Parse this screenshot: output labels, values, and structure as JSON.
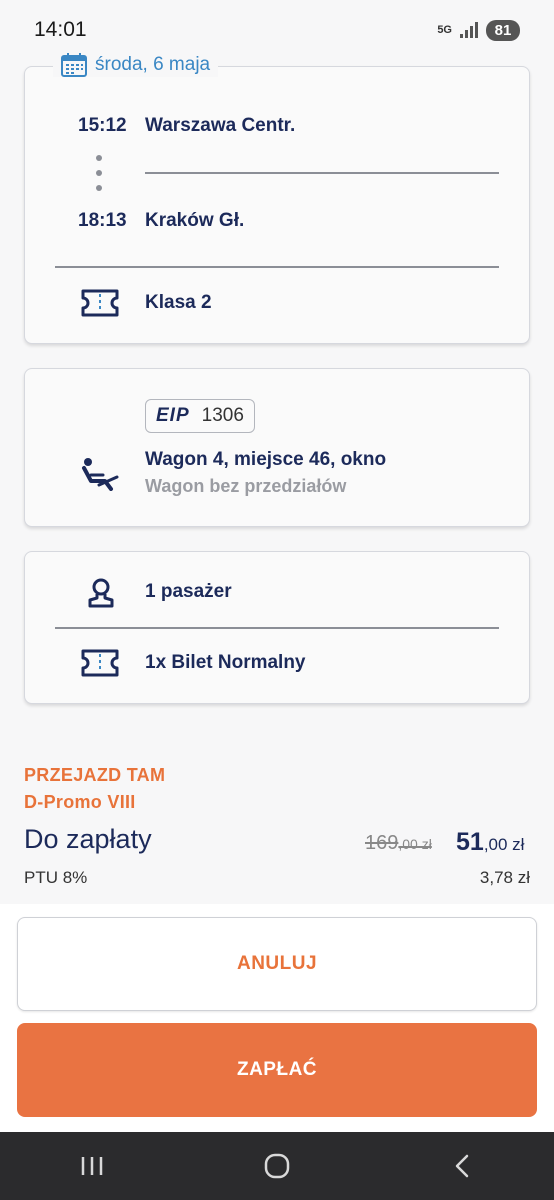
{
  "status": {
    "time": "14:01",
    "network": "5G",
    "battery": "81"
  },
  "journey": {
    "date": "środa, 6 maja",
    "departure_time": "15:12",
    "departure_station": "Warszawa Centr.",
    "arrival_time": "18:13",
    "arrival_station": "Kraków Gł.",
    "class": "Klasa 2"
  },
  "train": {
    "category": "EIP",
    "number": "1306",
    "seat": "Wagon 4, miejsce 46, okno",
    "carriage_type": "Wagon bez przedziałów"
  },
  "passengers": {
    "count": "1 pasażer",
    "ticket": "1x Bilet Normalny"
  },
  "summary": {
    "direction": "PRZEJAZD TAM",
    "offer": "D-Promo VIII",
    "pay_label": "Do zapłaty",
    "old_price_main": "169",
    "old_price_rest": ",00 zł",
    "new_price_main": "51",
    "new_price_rest": ",00 zł",
    "vat_label": "PTU 8%",
    "vat_value": "3,78 zł"
  },
  "buttons": {
    "cancel": "ANULUJ",
    "pay": "ZAPŁAĆ"
  },
  "colors": {
    "accent": "#e97342",
    "navy": "#1c2a5a",
    "link": "#3a87c4"
  },
  "icons": [
    "calendar-icon",
    "ticket-icon",
    "seat-icon",
    "person-icon",
    "recents-icon",
    "home-icon",
    "back-icon"
  ]
}
